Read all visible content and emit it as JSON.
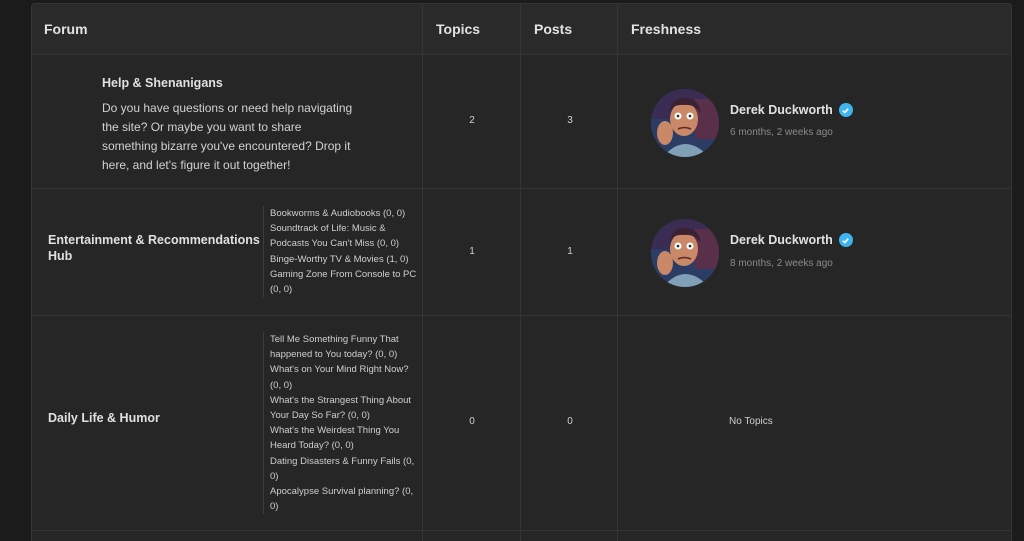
{
  "columns": {
    "forum": "Forum",
    "topics": "Topics",
    "posts": "Posts",
    "freshness": "Freshness"
  },
  "forums": [
    {
      "title": "Help & Shenanigans",
      "description_lines": [
        "Do you have questions or need help navigating",
        "the site? Or maybe you want to share",
        "something bizarre you've encountered? Drop it",
        "here, and let's figure it out together!"
      ],
      "topics": "2",
      "posts": "3",
      "author": "Derek Duckworth",
      "freshness": "6 months, 2 weeks ago"
    },
    {
      "title_lines": [
        "Entertainment & Recommendations",
        "Hub"
      ],
      "subforum_lines": [
        "Bookworms & Audiobooks (0, 0)",
        "Soundtrack of Life: Music &",
        "Podcasts You Can't Miss (0, 0)",
        "Binge-Worthy TV & Movies (1, 0)",
        "Gaming Zone From Console to PC",
        "(0, 0)"
      ],
      "topics": "1",
      "posts": "1",
      "author": "Derek Duckworth",
      "freshness": "8 months, 2 weeks ago"
    },
    {
      "title": "Daily Life & Humor",
      "subforum_lines": [
        "Tell Me Something Funny That",
        "happened to You today? (0, 0)",
        "What's on Your Mind Right Now?",
        "(0, 0)",
        "What's the Strangest Thing About",
        "Your Day So Far? (0, 0)",
        "What's the Weirdest Thing You",
        "Heard Today? (0, 0)",
        "Dating Disasters & Funny Fails (0,",
        "0)",
        "Apocalypse Survival planning? (0,",
        "0)"
      ],
      "topics": "0",
      "posts": "0",
      "freshness": "No Topics"
    }
  ],
  "colors": {
    "page_background": "#1b1b1c",
    "table_background": "#262627",
    "verified_badge": "#3fb5f0"
  },
  "icons": {
    "verified": "verified-check-icon",
    "avatar": "cartoon-man-avatar"
  }
}
